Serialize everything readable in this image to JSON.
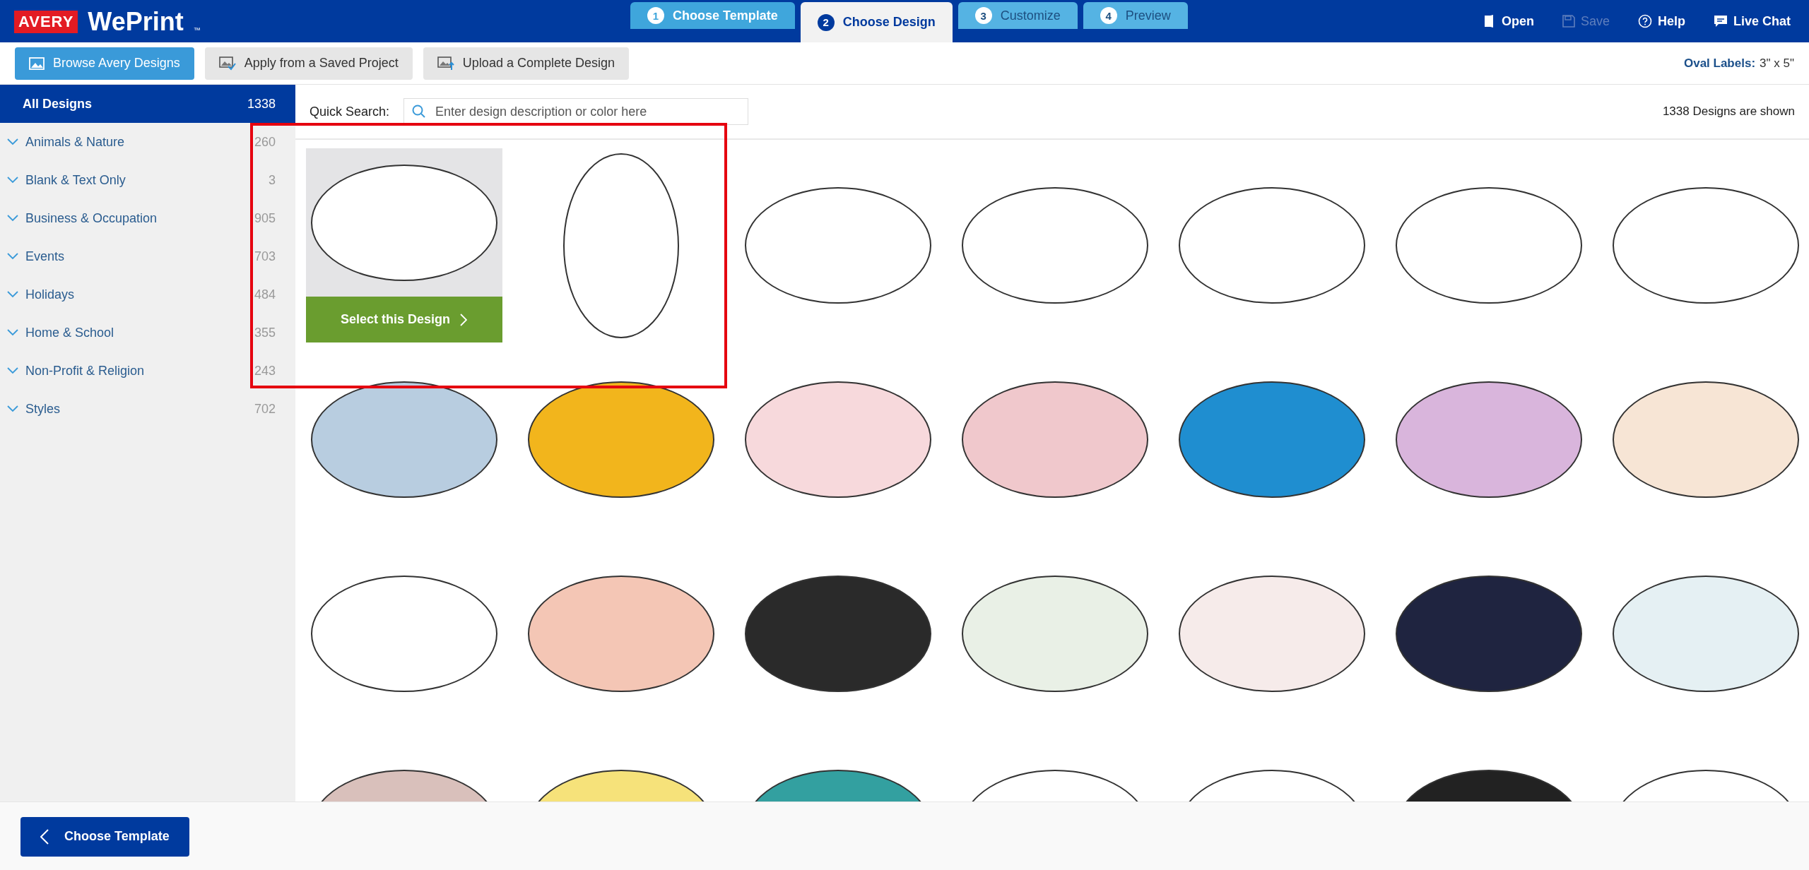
{
  "header": {
    "logo_brand": "AVERY",
    "logo_product": "WePrint",
    "logo_mark": "™",
    "tabs": [
      {
        "number": "1",
        "label": "Choose Template",
        "selected": false,
        "disabled": false
      },
      {
        "number": "2",
        "label": "Choose Design",
        "selected": true,
        "disabled": false
      },
      {
        "number": "3",
        "label": "Customize",
        "selected": false,
        "disabled": true
      },
      {
        "number": "4",
        "label": "Preview",
        "selected": false,
        "disabled": true
      }
    ],
    "actions": [
      {
        "kind": "open",
        "label": "Open",
        "disabled": false
      },
      {
        "kind": "save",
        "label": "Save",
        "disabled": true
      },
      {
        "kind": "help",
        "label": "Help",
        "disabled": false
      },
      {
        "kind": "chat",
        "label": "Live Chat",
        "disabled": false
      }
    ]
  },
  "toolbar": {
    "buttons": [
      {
        "kind": "browse",
        "label": "Browse Avery Designs",
        "selected": true
      },
      {
        "kind": "apply",
        "label": "Apply from a Saved Project",
        "selected": false
      },
      {
        "kind": "upload",
        "label": "Upload a Complete Design",
        "selected": false
      }
    ],
    "product_label": "Oval Labels:",
    "product_size": "3\" x 5\""
  },
  "sidebar": {
    "items": [
      {
        "label": "All Designs",
        "count": "1338",
        "selected": true
      },
      {
        "label": "Animals & Nature",
        "count": "260",
        "selected": false
      },
      {
        "label": "Blank & Text Only",
        "count": "3",
        "selected": false
      },
      {
        "label": "Business & Occupation",
        "count": "905",
        "selected": false
      },
      {
        "label": "Events",
        "count": "703",
        "selected": false
      },
      {
        "label": "Holidays",
        "count": "484",
        "selected": false
      },
      {
        "label": "Home & School",
        "count": "355",
        "selected": false
      },
      {
        "label": "Non-Profit & Religion",
        "count": "243",
        "selected": false
      },
      {
        "label": "Styles",
        "count": "702",
        "selected": false
      }
    ]
  },
  "search": {
    "label": "Quick Search:",
    "placeholder": "Enter design description or color here",
    "result_count": "1338 Designs are shown"
  },
  "designs": {
    "select_button": "Select this Design",
    "items": [
      {
        "kind": "horizontal",
        "color": "#ffffff",
        "selected": true
      },
      {
        "kind": "vertical",
        "color": "#ffffff",
        "selected": false
      },
      {
        "kind": "horizontal",
        "color": "#ffffff",
        "selected": false
      },
      {
        "kind": "horizontal",
        "color": "#ffffff",
        "selected": false
      },
      {
        "kind": "horizontal",
        "color": "#ffffff",
        "selected": false
      },
      {
        "kind": "horizontal",
        "color": "#ffffff",
        "selected": false
      },
      {
        "kind": "horizontal",
        "color": "#ffffff",
        "selected": false
      },
      {
        "kind": "horizontal",
        "color": "#b8cde0",
        "selected": false
      },
      {
        "kind": "horizontal",
        "color": "#f2b51c",
        "selected": false
      },
      {
        "kind": "horizontal",
        "color": "#f7d9dc",
        "selected": false
      },
      {
        "kind": "horizontal",
        "color": "#f0c8cc",
        "selected": false
      },
      {
        "kind": "horizontal",
        "color": "#1f8ed0",
        "selected": false
      },
      {
        "kind": "horizontal",
        "color": "#d9b5dc",
        "selected": false
      },
      {
        "kind": "horizontal",
        "color": "#f7e5d5",
        "selected": false
      },
      {
        "kind": "horizontal",
        "color": "#ffffff",
        "selected": false
      },
      {
        "kind": "horizontal",
        "color": "#f4c6b5",
        "selected": false
      },
      {
        "kind": "horizontal",
        "color": "#2a2a2a",
        "selected": false
      },
      {
        "kind": "horizontal",
        "color": "#e9f0e6",
        "selected": false
      },
      {
        "kind": "horizontal",
        "color": "#f6ebea",
        "selected": false
      },
      {
        "kind": "horizontal",
        "color": "#1f2440",
        "selected": false
      },
      {
        "kind": "horizontal",
        "color": "#e5f0f3",
        "selected": false
      },
      {
        "kind": "horizontal",
        "color": "#d9c0bb",
        "selected": false
      },
      {
        "kind": "horizontal",
        "color": "#f6e27a",
        "selected": false
      },
      {
        "kind": "horizontal",
        "color": "#33a0a0",
        "selected": false
      },
      {
        "kind": "horizontal",
        "color": "#ffffff",
        "selected": false
      },
      {
        "kind": "horizontal",
        "color": "#ffffff",
        "selected": false
      },
      {
        "kind": "horizontal",
        "color": "#222222",
        "selected": false
      },
      {
        "kind": "horizontal",
        "color": "#ffffff",
        "selected": false
      }
    ]
  },
  "highlight": {
    "shown": true
  },
  "footer": {
    "back_button": "Choose Template"
  }
}
